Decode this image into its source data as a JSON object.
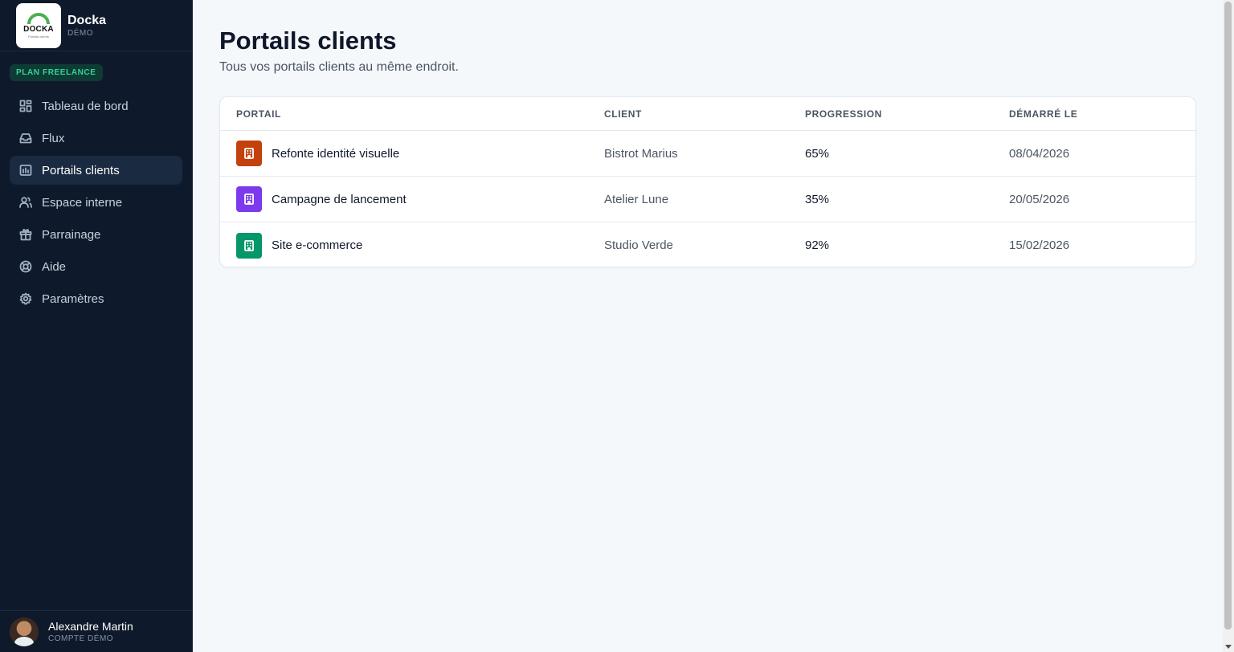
{
  "brand": {
    "logo_text": "DOCKA",
    "logo_subtext": "Portails clients",
    "name": "Docka",
    "tag": "DÉMO"
  },
  "plan_badge": "PLAN FREELANCE",
  "sidebar": {
    "items": [
      {
        "label": "Tableau de bord",
        "icon": "dashboard-icon",
        "active": false
      },
      {
        "label": "Flux",
        "icon": "inbox-icon",
        "active": false
      },
      {
        "label": "Portails clients",
        "icon": "portal-icon",
        "active": true
      },
      {
        "label": "Espace interne",
        "icon": "users-icon",
        "active": false
      },
      {
        "label": "Parrainage",
        "icon": "gift-icon",
        "active": false
      },
      {
        "label": "Aide",
        "icon": "lifebuoy-icon",
        "active": false
      },
      {
        "label": "Paramètres",
        "icon": "gear-icon",
        "active": false
      }
    ]
  },
  "user": {
    "name": "Alexandre Martin",
    "role": "COMPTE DÉMO"
  },
  "main": {
    "title": "Portails clients",
    "subtitle": "Tous vos portails clients au même endroit."
  },
  "table": {
    "headers": {
      "portal": "PORTAIL",
      "client": "CLIENT",
      "progress": "PROGRESSION",
      "started": "DÉMARRÉ LE"
    },
    "rows": [
      {
        "portal": "Refonte identité visuelle",
        "client": "Bistrot Marius",
        "progress": "65%",
        "started": "08/04/2026",
        "color": "#c2410c"
      },
      {
        "portal": "Campagne de lancement",
        "client": "Atelier Lune",
        "progress": "35%",
        "started": "20/05/2026",
        "color": "#7c3aed"
      },
      {
        "portal": "Site e-commerce",
        "client": "Studio Verde",
        "progress": "92%",
        "started": "15/02/2026",
        "color": "#059669"
      }
    ]
  }
}
